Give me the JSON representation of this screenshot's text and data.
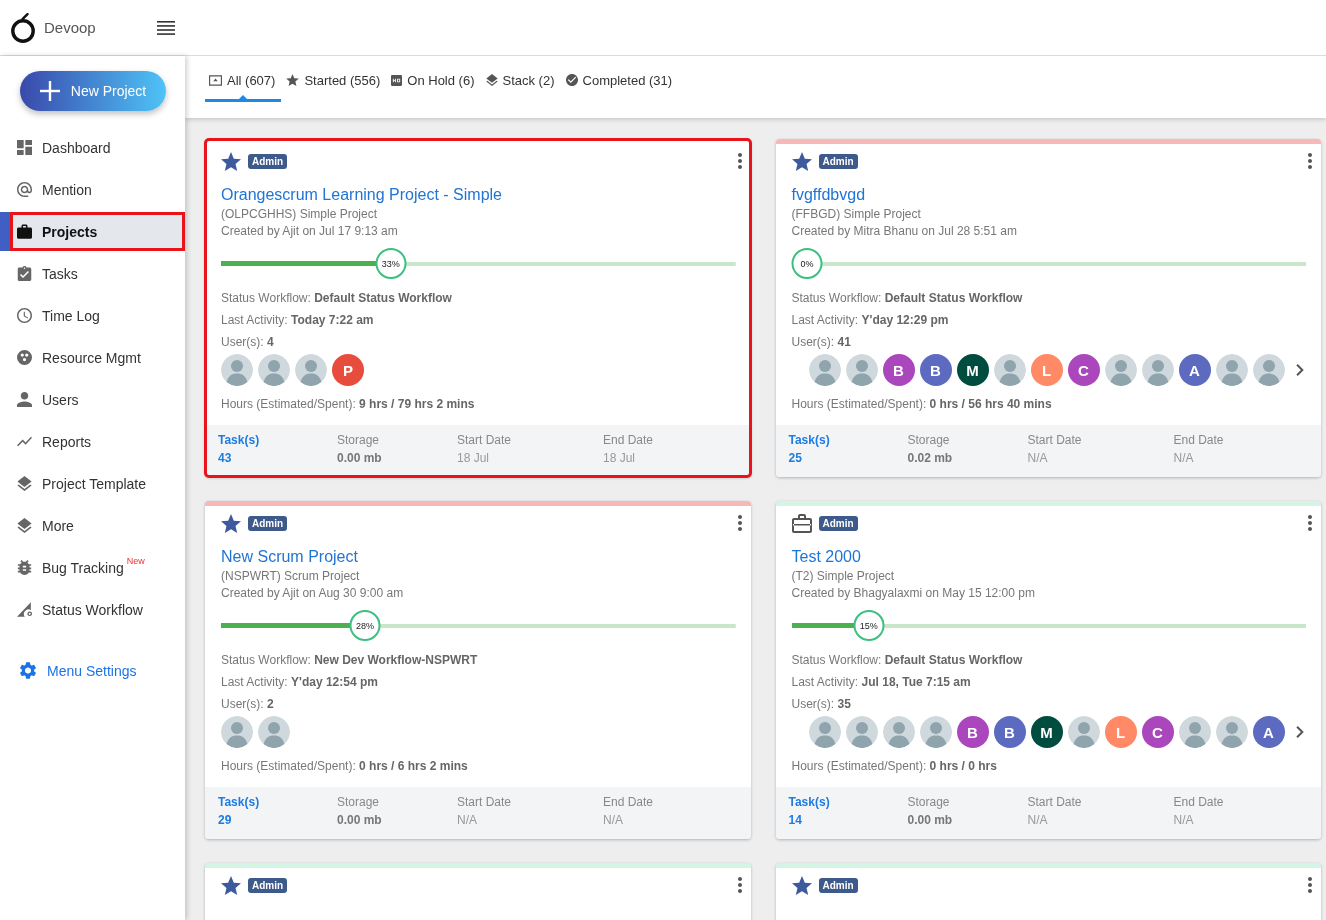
{
  "header": {
    "brand": "Devoop"
  },
  "sidebar": {
    "new_project_button": "New Project",
    "items": [
      {
        "label": "Dashboard",
        "selected": false,
        "highlighted": false
      },
      {
        "label": "Mention",
        "selected": false,
        "highlighted": false
      },
      {
        "label": "Projects",
        "selected": true,
        "highlighted": true
      },
      {
        "label": "Tasks",
        "selected": false,
        "highlighted": false
      },
      {
        "label": "Time Log",
        "selected": false,
        "highlighted": false
      },
      {
        "label": "Resource Mgmt",
        "selected": false,
        "highlighted": false
      },
      {
        "label": "Users",
        "selected": false,
        "highlighted": false
      },
      {
        "label": "Reports",
        "selected": false,
        "highlighted": false
      },
      {
        "label": "Project Template",
        "selected": false,
        "highlighted": false
      },
      {
        "label": "More",
        "selected": false,
        "highlighted": false
      },
      {
        "label": "Bug Tracking",
        "badge": "New",
        "selected": false,
        "highlighted": false
      },
      {
        "label": "Status Workflow",
        "selected": false,
        "highlighted": false
      }
    ],
    "settings_link": "Menu Settings"
  },
  "tabs": [
    {
      "label": "All (607)",
      "selected": true
    },
    {
      "label": "Started (556)",
      "selected": false
    },
    {
      "label": "On Hold (6)",
      "selected": false
    },
    {
      "label": "Stack (2)",
      "selected": false
    },
    {
      "label": "Completed (31)",
      "selected": false
    }
  ],
  "cards": [
    {
      "highlighted": true,
      "starred": true,
      "role": "Admin",
      "title": "Orangescrum Learning Project - Simple",
      "subtitle": "(OLPCGHHS) Simple Project",
      "created": "Created by Ajit on Jul 17 9:13 am",
      "progress": {
        "level": 0.33,
        "percent": "33%"
      },
      "status_workflow": "Status Workflow: **Default Status Workflow**",
      "last_activity": "Last Activity: **Today 7:22 am**",
      "users": "User(s): **4**",
      "avatars": [
        {
          "kind": "photo"
        },
        {
          "kind": "photo"
        },
        {
          "kind": "photo"
        },
        {
          "kind": "letter",
          "letter": "P",
          "color": "#e74c3c"
        }
      ],
      "more_avatars": false,
      "hours": "Hours (Estimated/Spent): **9 hrs / 79 hrs 2 mins**",
      "stats": [
        {
          "kind": "link",
          "label": "Task(s)",
          "value": "43"
        },
        {
          "kind": "bold",
          "label": "Storage",
          "value": "0.00 mb"
        },
        {
          "kind": "plain",
          "label": "Start Date",
          "value": "18 Jul"
        },
        {
          "kind": "plain",
          "label": "End Date",
          "value": "18 Jul"
        }
      ]
    },
    {
      "color": "#f9b8b8",
      "highlighted": false,
      "starred": true,
      "role": "Admin",
      "title": "fvgffdbvgd",
      "subtitle": "(FFBGD) Simple Project",
      "created": "Created by Mitra Bhanu on Jul 28 5:51 am",
      "progress": {
        "level": 0,
        "percent": "0%"
      },
      "status_workflow": "Status Workflow: **Default Status Workflow**",
      "last_activity": "Last Activity: **Y'day 12:29 pm**",
      "users": "User(s): **41**",
      "avatars": [
        {
          "kind": "photo"
        },
        {
          "kind": "photo"
        },
        {
          "kind": "letter",
          "letter": "B",
          "color": "#ab47bc"
        },
        {
          "kind": "letter",
          "letter": "B",
          "color": "#5c6bc0"
        },
        {
          "kind": "letter",
          "letter": "M",
          "color": "#004d40"
        },
        {
          "kind": "photo"
        },
        {
          "kind": "letter",
          "letter": "L",
          "color": "#ff8a65"
        },
        {
          "kind": "letter",
          "letter": "C",
          "color": "#ab47bc"
        },
        {
          "kind": "photo"
        },
        {
          "kind": "photo"
        },
        {
          "kind": "letter",
          "letter": "A",
          "color": "#5c6bc0"
        },
        {
          "kind": "photo"
        },
        {
          "kind": "photo"
        }
      ],
      "more_avatars": true,
      "hours": "Hours (Estimated/Spent): **0 hrs / 56 hrs 40 mins**",
      "stats": [
        {
          "kind": "link",
          "label": "Task(s)",
          "value": "25"
        },
        {
          "kind": "bold",
          "label": "Storage",
          "value": "0.02 mb"
        },
        {
          "kind": "plain",
          "label": "Start Date",
          "value": "N/A"
        },
        {
          "kind": "plain",
          "label": "End Date",
          "value": "N/A"
        }
      ]
    },
    {
      "color": "#f9b8b8",
      "highlighted": false,
      "starred": true,
      "role": "Admin",
      "title": "New Scrum Project",
      "subtitle": "(NSPWRT) Scrum Project",
      "created": "Created by Ajit on Aug 30 9:00 am",
      "progress": {
        "level": 0.28,
        "percent": "28%"
      },
      "status_workflow": "Status Workflow: **New Dev Workflow-NSPWRT**",
      "last_activity": "Last Activity: **Y'day 12:54 pm**",
      "users": "User(s): **2**",
      "avatars": [
        {
          "kind": "photo"
        },
        {
          "kind": "photo"
        }
      ],
      "more_avatars": false,
      "hours": "Hours (Estimated/Spent): **0 hrs / 6 hrs 2 mins**",
      "stats": [
        {
          "kind": "link",
          "label": "Task(s)",
          "value": "29"
        },
        {
          "kind": "bold",
          "label": "Storage",
          "value": "0.00 mb"
        },
        {
          "kind": "plain",
          "label": "Start Date",
          "value": "N/A"
        },
        {
          "kind": "plain",
          "label": "End Date",
          "value": "N/A"
        }
      ]
    },
    {
      "color": "#d4f5e6",
      "highlighted": false,
      "starred": false,
      "role": "Admin",
      "title": "Test 2000",
      "subtitle": "(T2) Simple Project",
      "created": "Created by Bhagyalaxmi on May 15 12:00 pm",
      "progress": {
        "level": 0.15,
        "percent": "15%"
      },
      "status_workflow": "Status Workflow: **Default Status Workflow**",
      "last_activity": "Last Activity: **Jul 18, Tue 7:15 am**",
      "users": "User(s): **35**",
      "avatars": [
        {
          "kind": "photo"
        },
        {
          "kind": "photo"
        },
        {
          "kind": "photo"
        },
        {
          "kind": "photo"
        },
        {
          "kind": "letter",
          "letter": "B",
          "color": "#ab47bc"
        },
        {
          "kind": "letter",
          "letter": "B",
          "color": "#5c6bc0"
        },
        {
          "kind": "letter",
          "letter": "M",
          "color": "#004d40"
        },
        {
          "kind": "photo"
        },
        {
          "kind": "letter",
          "letter": "L",
          "color": "#ff8a65"
        },
        {
          "kind": "letter",
          "letter": "C",
          "color": "#ab47bc"
        },
        {
          "kind": "photo"
        },
        {
          "kind": "photo"
        },
        {
          "kind": "letter",
          "letter": "A",
          "color": "#5c6bc0"
        }
      ],
      "more_avatars": true,
      "hours": "Hours (Estimated/Spent): **0 hrs / 0 hrs**",
      "stats": [
        {
          "kind": "link",
          "label": "Task(s)",
          "value": "14"
        },
        {
          "kind": "bold",
          "label": "Storage",
          "value": "0.00 mb"
        },
        {
          "kind": "plain",
          "label": "Start Date",
          "value": "N/A"
        },
        {
          "kind": "plain",
          "label": "End Date",
          "value": "N/A"
        }
      ]
    },
    {
      "color": "#d4f5e6",
      "highlighted": false,
      "starred": true,
      "role": "Admin"
    },
    {
      "color": "#d4f5e6",
      "highlighted": false,
      "starred": true,
      "role": "Admin"
    }
  ]
}
